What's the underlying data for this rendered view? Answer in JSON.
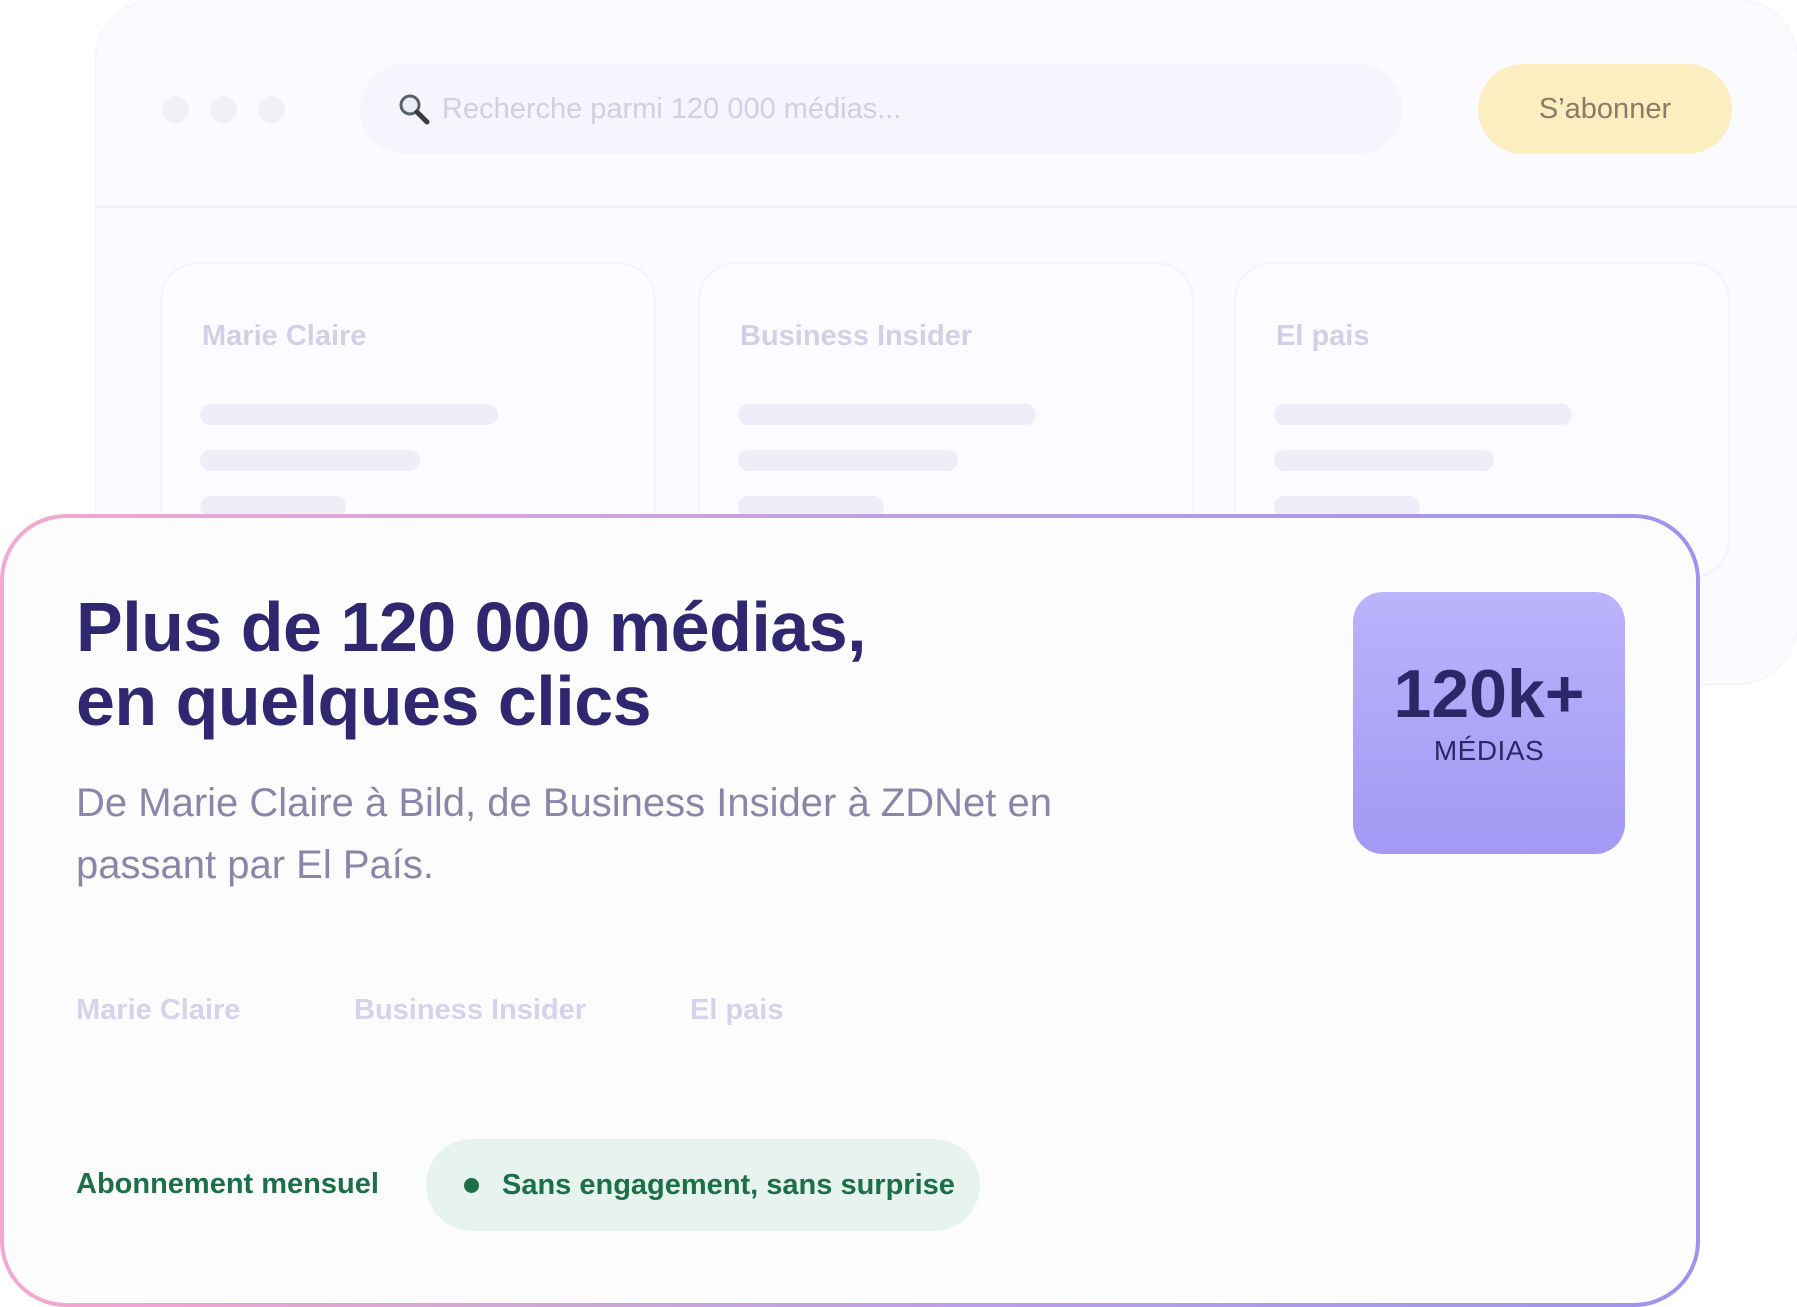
{
  "background_window": {
    "search": {
      "placeholder": "Recherche parmi 120 000 médias..."
    },
    "subscribe_label": "S’abonner",
    "cards": [
      {
        "title": "Marie Claire"
      },
      {
        "title": "Business Insider"
      },
      {
        "title": "El pais"
      }
    ]
  },
  "hero": {
    "headline_line1": "Plus de 120 000 médias,",
    "headline_line2": "en quelques clics",
    "subtitle": "De Marie Claire à Bild, de Business Insider à ZDNet en passant par El País.",
    "stat": {
      "value": "120k+",
      "label": "MÉDIAS"
    },
    "media_names": [
      "Marie Claire",
      "Business Insider",
      "El pais"
    ],
    "plan_label": "Abonnement mensuel",
    "pill_text": "Sans engagement, sans surprise"
  },
  "colors": {
    "headline": "#2f2870",
    "accent_purple": "#a199f4",
    "subscribe_button": "#fbeec0",
    "success_green": "#1c6f48",
    "pill_background": "#e7f3ee"
  },
  "icons": {
    "search": "magnifying-glass"
  }
}
